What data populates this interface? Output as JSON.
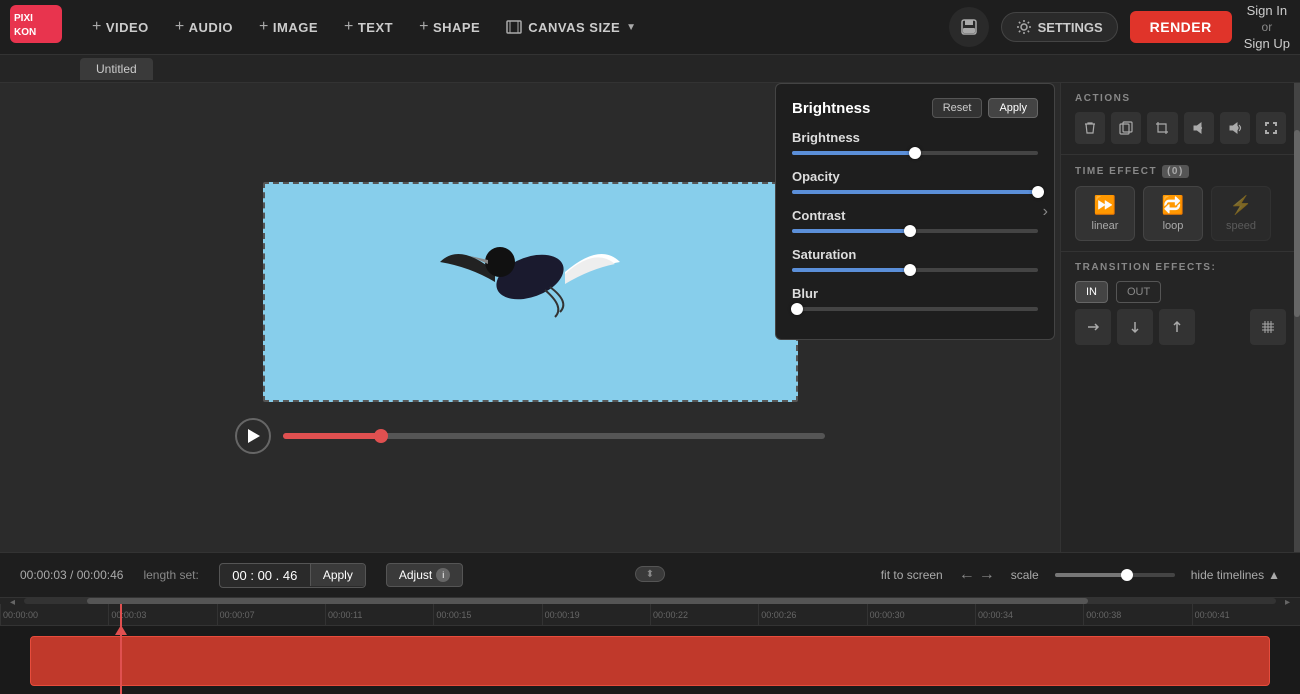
{
  "app": {
    "logo_text": "PIXIKO",
    "tab_label": "Untitled"
  },
  "nav": {
    "tools": [
      {
        "id": "video",
        "label": "VIDEO",
        "icon": "+"
      },
      {
        "id": "audio",
        "label": "AUDIO",
        "icon": "+"
      },
      {
        "id": "image",
        "label": "IMAGE",
        "icon": "+"
      },
      {
        "id": "text",
        "label": "TEXT",
        "icon": "+"
      },
      {
        "id": "shape",
        "label": "SHAPE",
        "icon": "+"
      }
    ],
    "canvas_size_label": "CANVAS SIZE",
    "settings_label": "SETTINGS",
    "render_label": "RENDER",
    "sign_in_label": "Sign In",
    "or_label": "or",
    "sign_up_label": "Sign Up"
  },
  "actions": {
    "section_label": "ACTIONS"
  },
  "time_effect": {
    "label": "TIME EFFECT",
    "badge": "(0)",
    "options": [
      {
        "id": "linear",
        "label": "linear"
      },
      {
        "id": "loop",
        "label": "loop"
      },
      {
        "id": "speed",
        "label": "speed"
      }
    ]
  },
  "transition": {
    "label": "TRANSITION",
    "effects_label": "EFFECTS:",
    "in_label": "IN",
    "out_label": "OUT"
  },
  "brightness_panel": {
    "title": "Brightness",
    "reset_label": "Reset",
    "apply_label": "Apply",
    "sliders": [
      {
        "id": "brightness",
        "label": "Brightness",
        "fill_pct": 50,
        "thumb_pct": 50
      },
      {
        "id": "opacity",
        "label": "Opacity",
        "fill_pct": 100,
        "thumb_pct": 100
      },
      {
        "id": "contrast",
        "label": "Contrast",
        "fill_pct": 48,
        "thumb_pct": 48
      },
      {
        "id": "saturation",
        "label": "Saturation",
        "fill_pct": 48,
        "thumb_pct": 48
      },
      {
        "id": "blur",
        "label": "Blur",
        "fill_pct": 2,
        "thumb_pct": 2
      }
    ]
  },
  "bottom_controls": {
    "time_display": "00:00:03 / 00:00:46",
    "length_label": "length set:",
    "time_input_value": "00 : 00 . 46",
    "apply_label": "Apply",
    "adjust_label": "Adjust",
    "fit_to_screen_label": "fit to screen",
    "scale_label": "scale",
    "hide_timelines_label": "hide timelines"
  },
  "timeline": {
    "ruler_marks": [
      "00:00:00",
      "00:00:03",
      "00:00:07",
      "00:00:11",
      "00:00:15",
      "00:00:19",
      "00:00:22",
      "00:00:26",
      "00:00:30",
      "00:00:34",
      "00:00:38",
      "00:00:41"
    ]
  }
}
